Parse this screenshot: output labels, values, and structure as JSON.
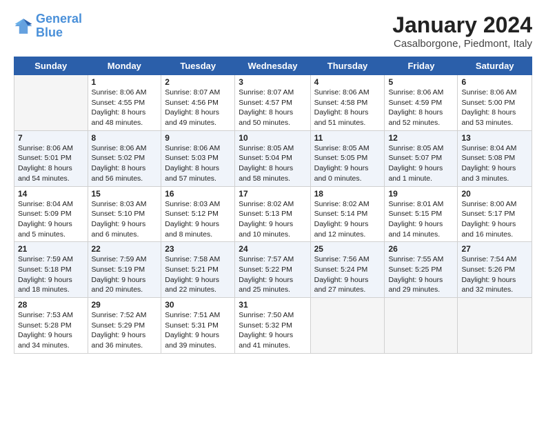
{
  "logo": {
    "line1": "General",
    "line2": "Blue"
  },
  "title": "January 2024",
  "subtitle": "Casalborgone, Piedmont, Italy",
  "weekdays": [
    "Sunday",
    "Monday",
    "Tuesday",
    "Wednesday",
    "Thursday",
    "Friday",
    "Saturday"
  ],
  "weeks": [
    [
      {
        "day": "",
        "info": ""
      },
      {
        "day": "1",
        "info": "Sunrise: 8:06 AM\nSunset: 4:55 PM\nDaylight: 8 hours\nand 48 minutes."
      },
      {
        "day": "2",
        "info": "Sunrise: 8:07 AM\nSunset: 4:56 PM\nDaylight: 8 hours\nand 49 minutes."
      },
      {
        "day": "3",
        "info": "Sunrise: 8:07 AM\nSunset: 4:57 PM\nDaylight: 8 hours\nand 50 minutes."
      },
      {
        "day": "4",
        "info": "Sunrise: 8:06 AM\nSunset: 4:58 PM\nDaylight: 8 hours\nand 51 minutes."
      },
      {
        "day": "5",
        "info": "Sunrise: 8:06 AM\nSunset: 4:59 PM\nDaylight: 8 hours\nand 52 minutes."
      },
      {
        "day": "6",
        "info": "Sunrise: 8:06 AM\nSunset: 5:00 PM\nDaylight: 8 hours\nand 53 minutes."
      }
    ],
    [
      {
        "day": "7",
        "info": "Sunrise: 8:06 AM\nSunset: 5:01 PM\nDaylight: 8 hours\nand 54 minutes."
      },
      {
        "day": "8",
        "info": "Sunrise: 8:06 AM\nSunset: 5:02 PM\nDaylight: 8 hours\nand 56 minutes."
      },
      {
        "day": "9",
        "info": "Sunrise: 8:06 AM\nSunset: 5:03 PM\nDaylight: 8 hours\nand 57 minutes."
      },
      {
        "day": "10",
        "info": "Sunrise: 8:05 AM\nSunset: 5:04 PM\nDaylight: 8 hours\nand 58 minutes."
      },
      {
        "day": "11",
        "info": "Sunrise: 8:05 AM\nSunset: 5:05 PM\nDaylight: 9 hours\nand 0 minutes."
      },
      {
        "day": "12",
        "info": "Sunrise: 8:05 AM\nSunset: 5:07 PM\nDaylight: 9 hours\nand 1 minute."
      },
      {
        "day": "13",
        "info": "Sunrise: 8:04 AM\nSunset: 5:08 PM\nDaylight: 9 hours\nand 3 minutes."
      }
    ],
    [
      {
        "day": "14",
        "info": "Sunrise: 8:04 AM\nSunset: 5:09 PM\nDaylight: 9 hours\nand 5 minutes."
      },
      {
        "day": "15",
        "info": "Sunrise: 8:03 AM\nSunset: 5:10 PM\nDaylight: 9 hours\nand 6 minutes."
      },
      {
        "day": "16",
        "info": "Sunrise: 8:03 AM\nSunset: 5:12 PM\nDaylight: 9 hours\nand 8 minutes."
      },
      {
        "day": "17",
        "info": "Sunrise: 8:02 AM\nSunset: 5:13 PM\nDaylight: 9 hours\nand 10 minutes."
      },
      {
        "day": "18",
        "info": "Sunrise: 8:02 AM\nSunset: 5:14 PM\nDaylight: 9 hours\nand 12 minutes."
      },
      {
        "day": "19",
        "info": "Sunrise: 8:01 AM\nSunset: 5:15 PM\nDaylight: 9 hours\nand 14 minutes."
      },
      {
        "day": "20",
        "info": "Sunrise: 8:00 AM\nSunset: 5:17 PM\nDaylight: 9 hours\nand 16 minutes."
      }
    ],
    [
      {
        "day": "21",
        "info": "Sunrise: 7:59 AM\nSunset: 5:18 PM\nDaylight: 9 hours\nand 18 minutes."
      },
      {
        "day": "22",
        "info": "Sunrise: 7:59 AM\nSunset: 5:19 PM\nDaylight: 9 hours\nand 20 minutes."
      },
      {
        "day": "23",
        "info": "Sunrise: 7:58 AM\nSunset: 5:21 PM\nDaylight: 9 hours\nand 22 minutes."
      },
      {
        "day": "24",
        "info": "Sunrise: 7:57 AM\nSunset: 5:22 PM\nDaylight: 9 hours\nand 25 minutes."
      },
      {
        "day": "25",
        "info": "Sunrise: 7:56 AM\nSunset: 5:24 PM\nDaylight: 9 hours\nand 27 minutes."
      },
      {
        "day": "26",
        "info": "Sunrise: 7:55 AM\nSunset: 5:25 PM\nDaylight: 9 hours\nand 29 minutes."
      },
      {
        "day": "27",
        "info": "Sunrise: 7:54 AM\nSunset: 5:26 PM\nDaylight: 9 hours\nand 32 minutes."
      }
    ],
    [
      {
        "day": "28",
        "info": "Sunrise: 7:53 AM\nSunset: 5:28 PM\nDaylight: 9 hours\nand 34 minutes."
      },
      {
        "day": "29",
        "info": "Sunrise: 7:52 AM\nSunset: 5:29 PM\nDaylight: 9 hours\nand 36 minutes."
      },
      {
        "day": "30",
        "info": "Sunrise: 7:51 AM\nSunset: 5:31 PM\nDaylight: 9 hours\nand 39 minutes."
      },
      {
        "day": "31",
        "info": "Sunrise: 7:50 AM\nSunset: 5:32 PM\nDaylight: 9 hours\nand 41 minutes."
      },
      {
        "day": "",
        "info": ""
      },
      {
        "day": "",
        "info": ""
      },
      {
        "day": "",
        "info": ""
      }
    ]
  ]
}
